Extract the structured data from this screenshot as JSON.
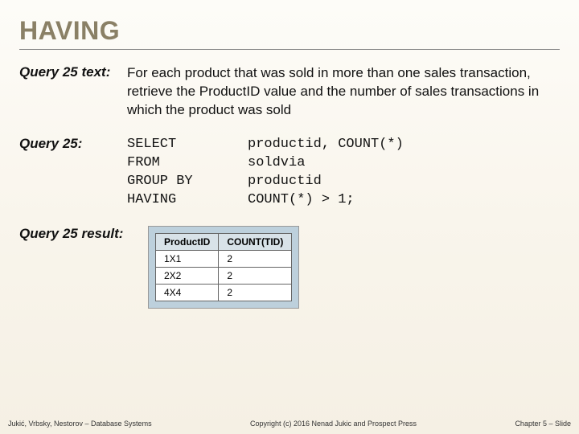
{
  "title": "HAVING",
  "query_text_label": "Query 25 text:",
  "query_text_body": "For each product that was sold in more than one sales transaction, retrieve the ProductID value and the number of sales transactions in which the product was sold",
  "query_sql_label": "Query 25:",
  "sql": {
    "k1": "SELECT",
    "a1": "productid, COUNT(*)",
    "k2": "FROM",
    "a2": "soldvia",
    "k3": "GROUP BY",
    "a3": "productid",
    "k4": "HAVING",
    "a4": "COUNT(*) > 1;"
  },
  "query_result_label": "Query 25 result:",
  "table": {
    "h1": "ProductID",
    "h2": "COUNT(TID)",
    "r1c1": "1X1",
    "r1c2": "2",
    "r2c1": "2X2",
    "r2c2": "2",
    "r3c1": "4X4",
    "r3c2": "2"
  },
  "footer": {
    "left": "Jukić, Vrbsky, Nestorov – Database Systems",
    "center": "Copyright (c) 2016 Nenad Jukic and Prospect Press",
    "right": "Chapter 5 – Slide"
  }
}
